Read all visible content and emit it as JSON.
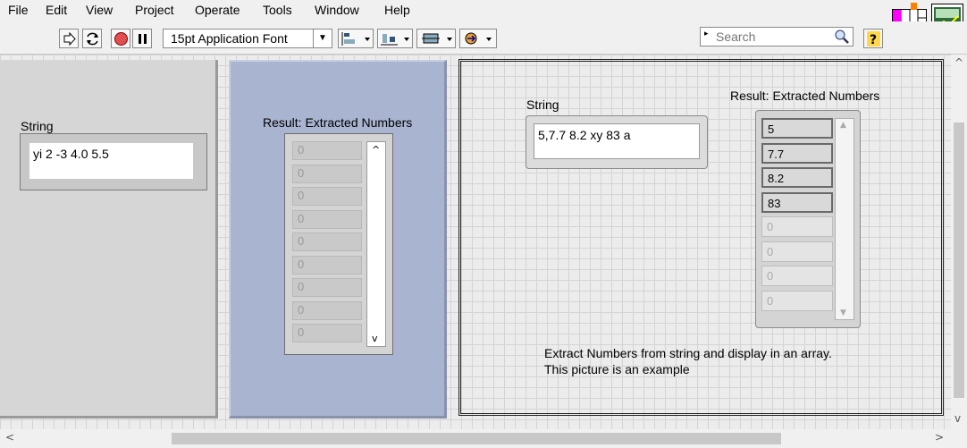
{
  "menu": [
    "File",
    "Edit",
    "View",
    "Project",
    "Operate",
    "Tools",
    "Window",
    "Help"
  ],
  "toolbar": {
    "font_label": "15pt Application Font",
    "search_placeholder": "Search",
    "help_label": "?"
  },
  "panel_left": {
    "string_label": "String",
    "string_value": "yi 2 -3 4.0 5.5"
  },
  "panel_middle": {
    "result_label": "Result: Extracted Numbers",
    "values": [
      "0",
      "0",
      "0",
      "0",
      "0",
      "0",
      "0",
      "0",
      "0"
    ]
  },
  "panel_right": {
    "string_label": "String",
    "string_value": "5,7.7 8.2 xy 83 a",
    "result_label": "Result: Extracted Numbers",
    "values": [
      "5",
      "7.7",
      "8.2",
      "83",
      "0",
      "0",
      "0",
      "0"
    ],
    "active_count": 4,
    "caption_line1": "Extract Numbers from string and display in an array.",
    "caption_line2": "This picture is an example"
  },
  "vi_icon_number": "1",
  "colors": {
    "panel_gray": "#d6d6d6",
    "panel_blue": "#a9b4d0",
    "canvas": "#ececec"
  }
}
